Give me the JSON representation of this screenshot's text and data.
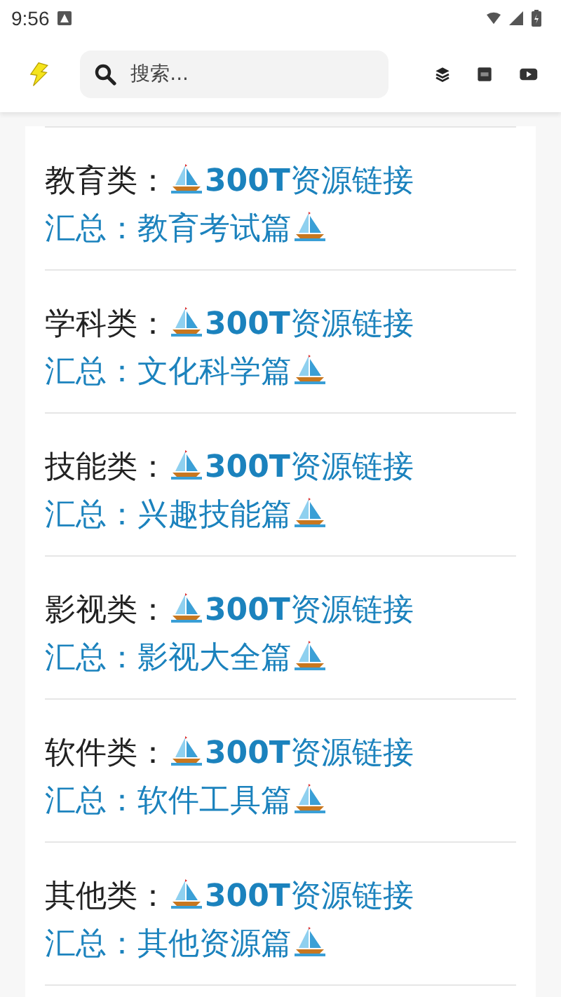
{
  "status_bar": {
    "time": "9:56"
  },
  "search": {
    "placeholder": "搜索..."
  },
  "articles": [
    {
      "category": "教育类：",
      "title_line_1": "**300T**资源链接",
      "title_line_2": "汇总：教育考试篇"
    },
    {
      "category": "学科类：",
      "title_line_1": "**300T**资源链接",
      "title_line_2": "汇总：文化科学篇"
    },
    {
      "category": "技能类：",
      "title_line_1": "**300T**资源链接",
      "title_line_2": "汇总：兴趣技能篇"
    },
    {
      "category": "影视类：",
      "title_line_1": "**300T**资源链接",
      "title_line_2": "汇总：影视大全篇"
    },
    {
      "category": "软件类：",
      "title_line_1": "**300T**资源链接",
      "title_line_2": "汇总：软件工具篇"
    },
    {
      "category": "其他类：",
      "title_line_1": "**300T**资源链接",
      "title_line_2": "汇总：其他资源篇"
    }
  ]
}
